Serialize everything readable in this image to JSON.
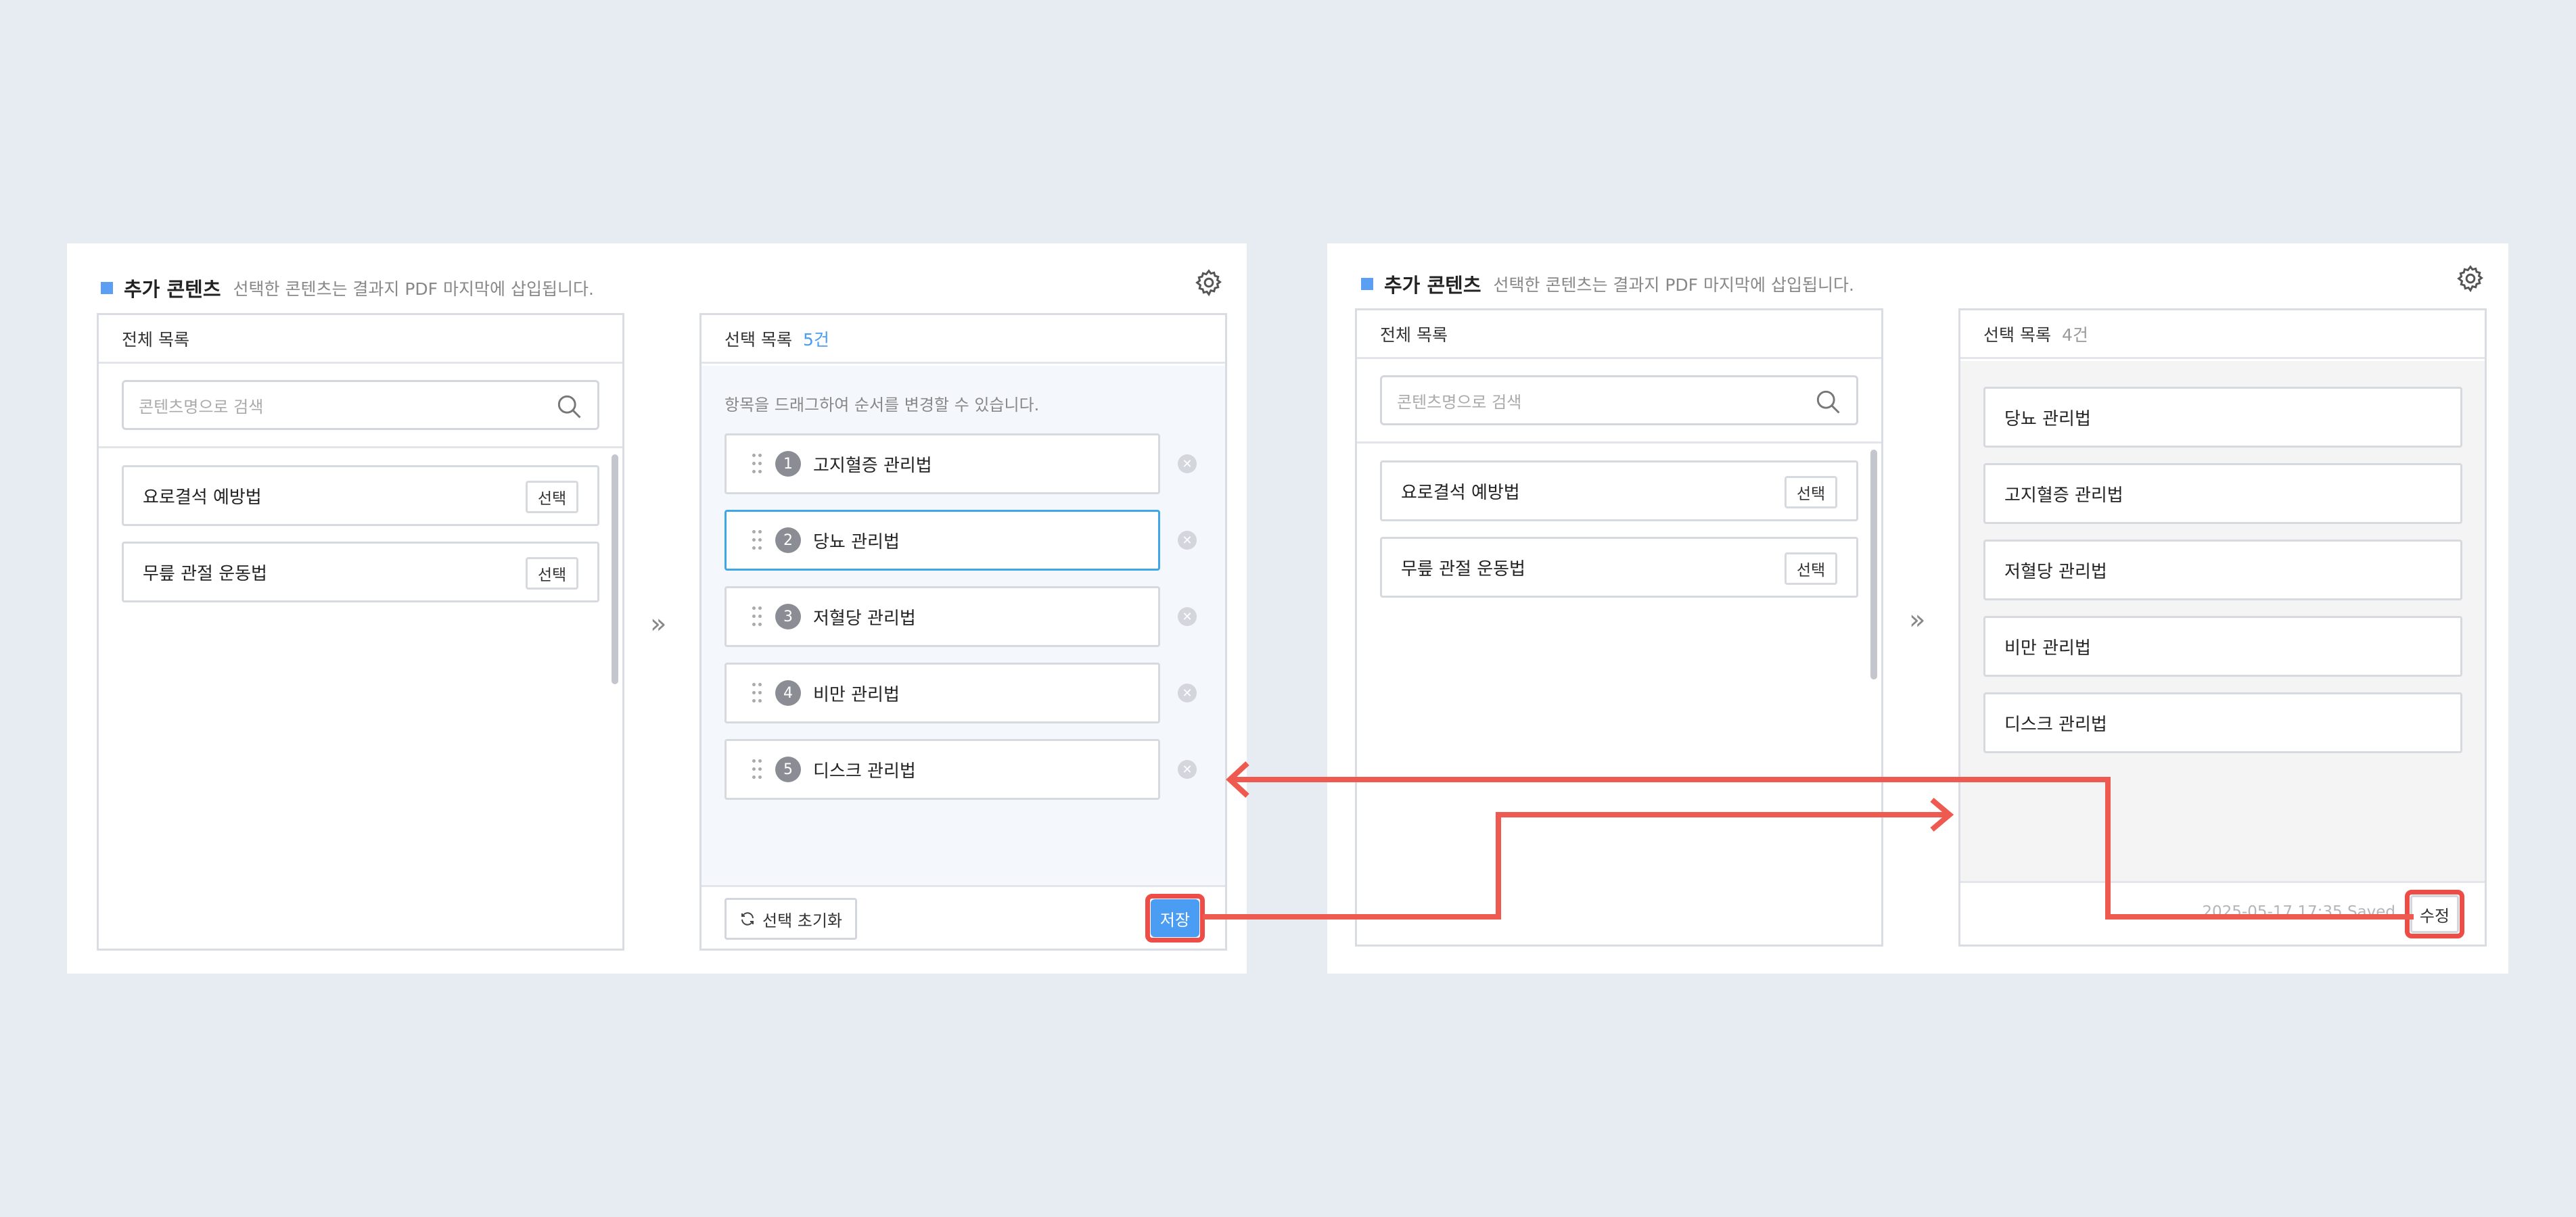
{
  "header": {
    "title": "추가 콘텐츠",
    "desc": "선택한 콘텐츠는 결과지 PDF 마지막에 삽입됩니다."
  },
  "all_list": {
    "title": "전체 목록",
    "search_placeholder": "콘텐츠명으로 검색",
    "select_label": "선택",
    "items": [
      "요로결석 예방법",
      "무릎 관절 운동법"
    ]
  },
  "before": {
    "sel_title": "선택 목록",
    "sel_count": "5건",
    "hint": "항목을 드래그하여 순서를 변경할 수 있습니다.",
    "items": [
      {
        "num": "1",
        "label": "고지혈증 관리법"
      },
      {
        "num": "2",
        "label": "당뇨 관리법"
      },
      {
        "num": "3",
        "label": "저혈당 관리법"
      },
      {
        "num": "4",
        "label": "비만 관리법"
      },
      {
        "num": "5",
        "label": "디스크 관리법"
      }
    ],
    "reset_label": "선택 초기화",
    "save_label": "저장"
  },
  "after": {
    "sel_title": "선택 목록",
    "sel_count": "4건",
    "items": [
      "당뇨 관리법",
      "고지혈증 관리법",
      "저혈당 관리법",
      "비만 관리법",
      "디스크 관리법"
    ],
    "saved_text": "2025-05-17 17:35 Saved",
    "edit_label": "수정"
  },
  "colors": {
    "accent": "#4a9df3",
    "highlight": "#ee4c47",
    "count_blue": "#4a9df3",
    "count_grey": "#999999"
  }
}
